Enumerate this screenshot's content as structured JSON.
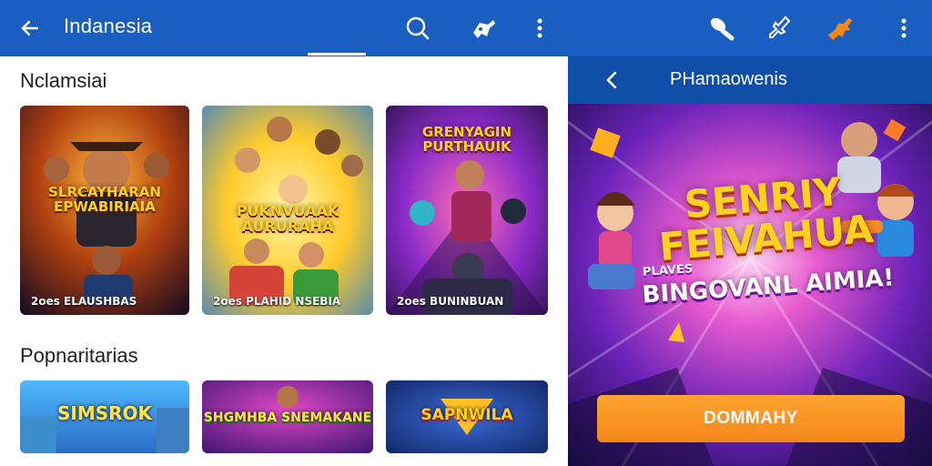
{
  "appbar": {
    "title": "Indanesia",
    "icons": [
      "back-arrow-icon",
      "search-icon",
      "gamepad-icon",
      "more-vert-icon",
      "joystick-icon",
      "pin-icon",
      "character-icon",
      "more-vert-icon"
    ],
    "color": "#1a5ec2"
  },
  "sections": [
    {
      "title": "Nclamsiai",
      "tiles": [
        {
          "title": "SLRCAYHARAN EPWABIRIAIA",
          "caption": "2oes ELAUSHBAS"
        },
        {
          "title": "PUKNVUAAK AURURAHA",
          "caption": "2oes PLAHID NSEBIA"
        },
        {
          "title": "GRENYAGIN PURTHAUIK",
          "caption": "2oes BUNINBUAN"
        }
      ]
    },
    {
      "title": "Popnaritarias",
      "tiles": [
        {
          "title": "SIMSROK",
          "caption": ""
        },
        {
          "title": "SHGMHBA SNEMAKANE",
          "caption": ""
        },
        {
          "title": "SAPNWILA",
          "caption": ""
        }
      ]
    }
  ],
  "right_panel": {
    "title": "PHamaowenis",
    "promo_title": "SENRIY FEIVAHUA",
    "promo_sub": "BINGOVANL AIMIA!",
    "promo_small": "PLAVES",
    "cta_label": "DOMMAHY",
    "accent": "#f4861a"
  }
}
